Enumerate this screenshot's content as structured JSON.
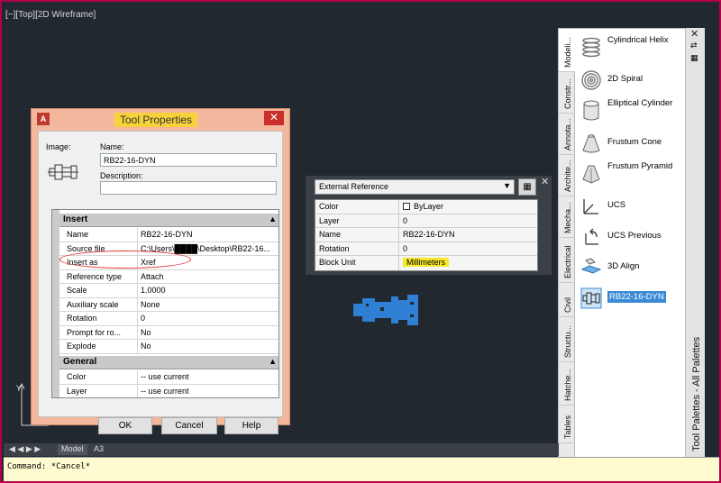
{
  "viewport": {
    "label": "[−][Top][2D Wireframe]"
  },
  "tool_properties": {
    "title": "Tool Properties",
    "close": "✕",
    "image_label": "Image:",
    "name_label": "Name:",
    "name_value": "RB22-16-DYN",
    "description_label": "Description:",
    "description_value": "",
    "sections": [
      {
        "title": "Insert",
        "rows": [
          {
            "key": "Name",
            "value": "RB22-16-DYN"
          },
          {
            "key": "Source file",
            "value": "C:\\Users\\████\\Desktop\\RB22-16..."
          },
          {
            "key": "Insert as",
            "value": "Xref"
          },
          {
            "key": "Reference type",
            "value": "Attach"
          },
          {
            "key": "Scale",
            "value": "1.0000"
          },
          {
            "key": "Auxiliary scale",
            "value": "None"
          },
          {
            "key": "Rotation",
            "value": "0"
          },
          {
            "key": "Prompt for ro...",
            "value": "No"
          },
          {
            "key": "Explode",
            "value": "No"
          }
        ]
      },
      {
        "title": "General",
        "rows": [
          {
            "key": "Color",
            "value": "-- use current"
          },
          {
            "key": "Layer",
            "value": "-- use current"
          }
        ]
      }
    ],
    "buttons": {
      "ok": "OK",
      "cancel": "Cancel",
      "help": "Help"
    }
  },
  "external_reference": {
    "combo": "External Reference",
    "close": "✕",
    "rows": [
      {
        "key": "Color",
        "value": "ByLayer"
      },
      {
        "key": "Layer",
        "value": "0"
      },
      {
        "key": "Name",
        "value": "RB22-16-DYN"
      },
      {
        "key": "Rotation",
        "value": "0"
      },
      {
        "key": "Block Unit",
        "value": "Millimeters"
      }
    ]
  },
  "palette": {
    "title": "Tool Palettes - All Palettes",
    "tabs": [
      "Modeli...",
      "Constr...",
      "Annota...",
      "Archite...",
      "Mecha...",
      "Electrical",
      "Civil",
      "Structu...",
      "Hatche...",
      "Tables"
    ],
    "items": [
      {
        "label": "Cylindrical Helix",
        "icon": "helix-icon"
      },
      {
        "label": "2D Spiral",
        "icon": "spiral-icon"
      },
      {
        "label": "Elliptical Cylinder",
        "icon": "cylinder-icon"
      },
      {
        "label": "Frustum Cone",
        "icon": "cone-icon"
      },
      {
        "label": "Frustum Pyramid",
        "icon": "pyramid-icon"
      },
      {
        "label": "UCS",
        "icon": "ucs-icon"
      },
      {
        "label": "UCS Previous",
        "icon": "ucs-previous-icon"
      },
      {
        "label": "3D Align",
        "icon": "align-icon"
      },
      {
        "label": "RB22-16-DYN",
        "icon": "block-icon"
      }
    ]
  },
  "layout_tabs": {
    "nav": "◀ ◀ ▶ ▶",
    "model": "Model",
    "a3": "A3"
  },
  "command": {
    "text": "Command: *Cancel*"
  },
  "ucs_axis": {
    "y": "Y"
  },
  "colors": {
    "canvas": "#212830",
    "dialog": "#f2b79c",
    "highlight": "#f7e92a",
    "block": "#2f7fd4",
    "annotation": "#e0302a"
  }
}
